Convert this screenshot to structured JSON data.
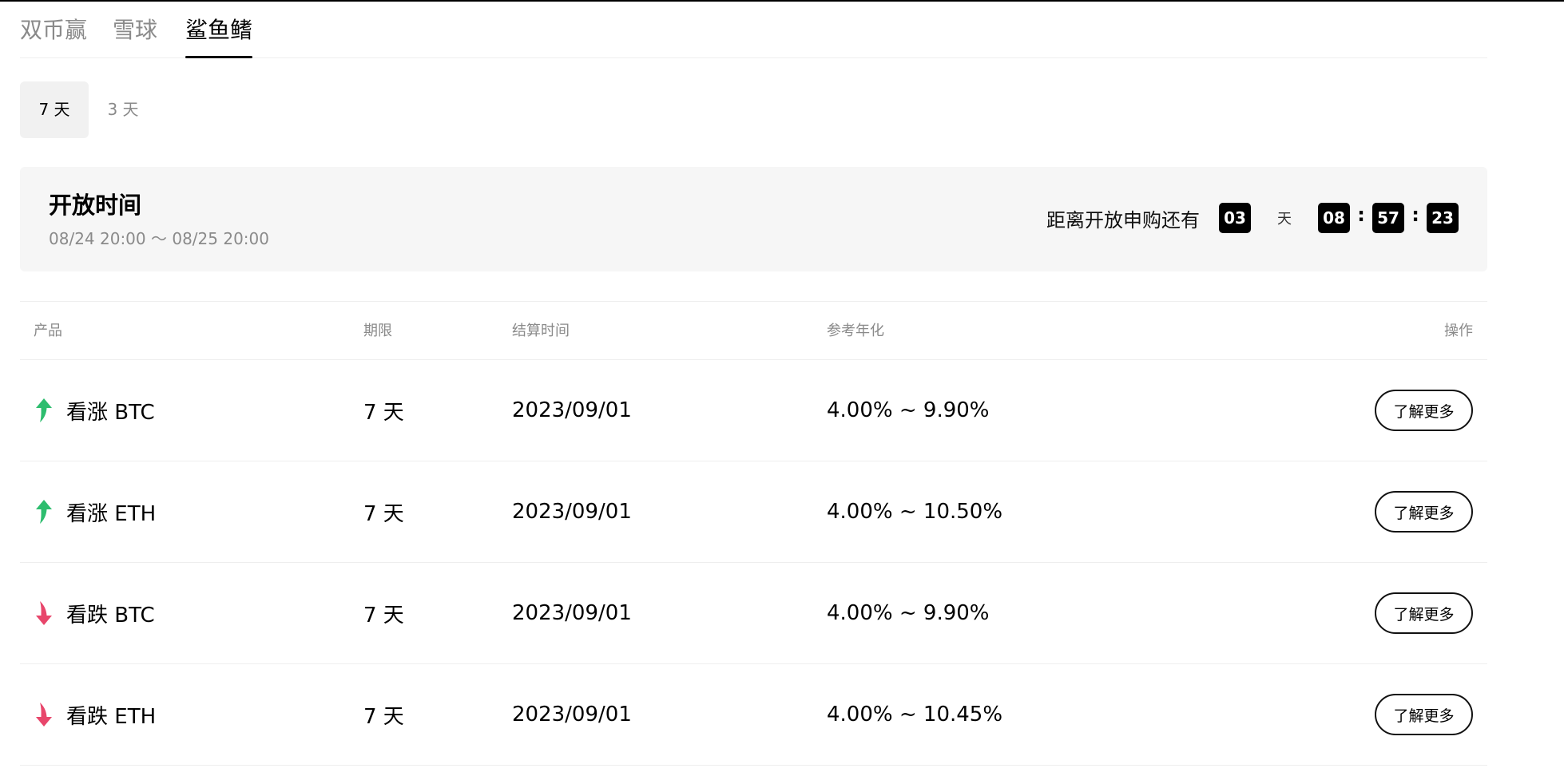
{
  "tabs": [
    {
      "label": "双币赢",
      "active": false
    },
    {
      "label": "雪球",
      "active": false
    },
    {
      "label": "鲨鱼鳍",
      "active": true
    }
  ],
  "periods": [
    {
      "label": "7 天",
      "active": true
    },
    {
      "label": "3 天",
      "active": false
    }
  ],
  "open_card": {
    "title": "开放时间",
    "range": "08/24 20:00 ～ 08/25 20:00",
    "countdown_label": "距离开放申购还有",
    "days": "03",
    "day_unit": "天",
    "hours": "08",
    "minutes": "57",
    "seconds": "23",
    "separator": ":"
  },
  "table": {
    "headers": {
      "product": "产品",
      "term": "期限",
      "settle": "结算时间",
      "apr": "参考年化",
      "action": "操作"
    },
    "rows": [
      {
        "direction": "up",
        "product": "看涨 BTC",
        "term": "7 天",
        "settle": "2023/09/01",
        "apr": "4.00% ~ 9.90%",
        "action": "了解更多"
      },
      {
        "direction": "up",
        "product": "看涨 ETH",
        "term": "7 天",
        "settle": "2023/09/01",
        "apr": "4.00% ~ 10.50%",
        "action": "了解更多"
      },
      {
        "direction": "down",
        "product": "看跌 BTC",
        "term": "7 天",
        "settle": "2023/09/01",
        "apr": "4.00% ~ 9.90%",
        "action": "了解更多"
      },
      {
        "direction": "down",
        "product": "看跌 ETH",
        "term": "7 天",
        "settle": "2023/09/01",
        "apr": "4.00% ~ 10.45%",
        "action": "了解更多"
      }
    ]
  },
  "colors": {
    "up": "#2dbd6e",
    "down": "#e8466b"
  }
}
